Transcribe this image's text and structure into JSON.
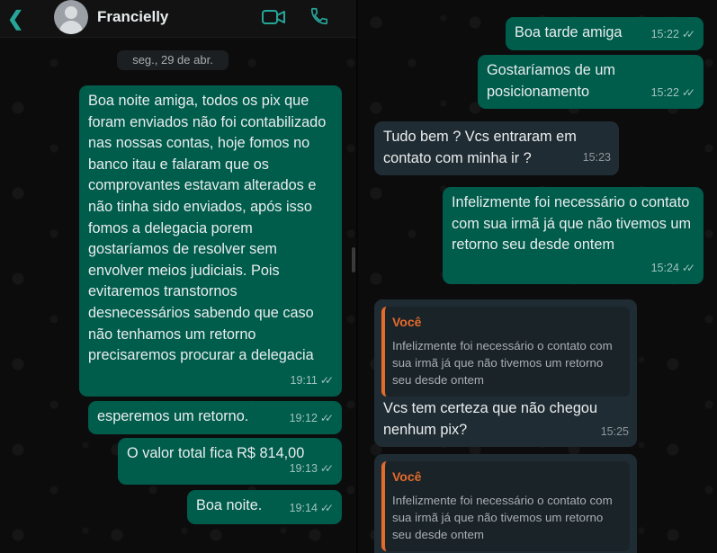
{
  "header": {
    "contact_name": "Francielly",
    "back_icon": "chevron-left-icon",
    "video_icon": "video-call-icon",
    "phone_icon": "voice-call-icon",
    "accent": "#26a69a"
  },
  "date_chip": "seg., 29 de abr.",
  "left_messages": [
    {
      "text": "Boa noite amiga, todos os pix que foram enviados não foi contabilizado nas nossas contas, hoje fomos no banco itau e falaram que os comprovantes estavam alterados e não tinha sido enviados, após isso fomos a delegacia porem gostaríamos de resolver sem envolver meios judiciais. Pois evitaremos transtornos desnecessários sabendo que caso não tenhamos um retorno precisaremos procurar a delegacia",
      "time": "19:11"
    },
    {
      "text": "esperemos um retorno.",
      "time": "19:12"
    },
    {
      "text": "O valor total fica R$ 814,00",
      "time": "19:13"
    },
    {
      "text": "Boa noite.",
      "time": "19:14"
    }
  ],
  "right_messages": [
    {
      "text": "Boa tarde amiga",
      "time": "15:22"
    },
    {
      "text": "Gostaríamos de um posicionamento",
      "time": "15:22"
    },
    {
      "text": "Tudo bem ? Vcs entraram em contato com minha ir ?",
      "time": "15:23"
    },
    {
      "text": "Infelizmente foi necessário o contato com sua irmã já que não tivemos um retorno seu desde ontem",
      "time": "15:24"
    },
    {
      "quote_author": "Você",
      "quote_text": "Infelizmente foi necessário o contato com sua irmã já que não tivemos um retorno seu desde ontem",
      "text": "Vcs tem certeza que não chegou nenhum pix?",
      "time": "15:25"
    },
    {
      "quote_author": "Você",
      "quote_text": "Infelizmente foi necessário o contato com sua irmã já que não tivemos um retorno seu desde ontem"
    }
  ],
  "colors": {
    "outgoing": "#005c4b",
    "incoming": "#202c33",
    "quote_accent": "#e56b2b"
  }
}
